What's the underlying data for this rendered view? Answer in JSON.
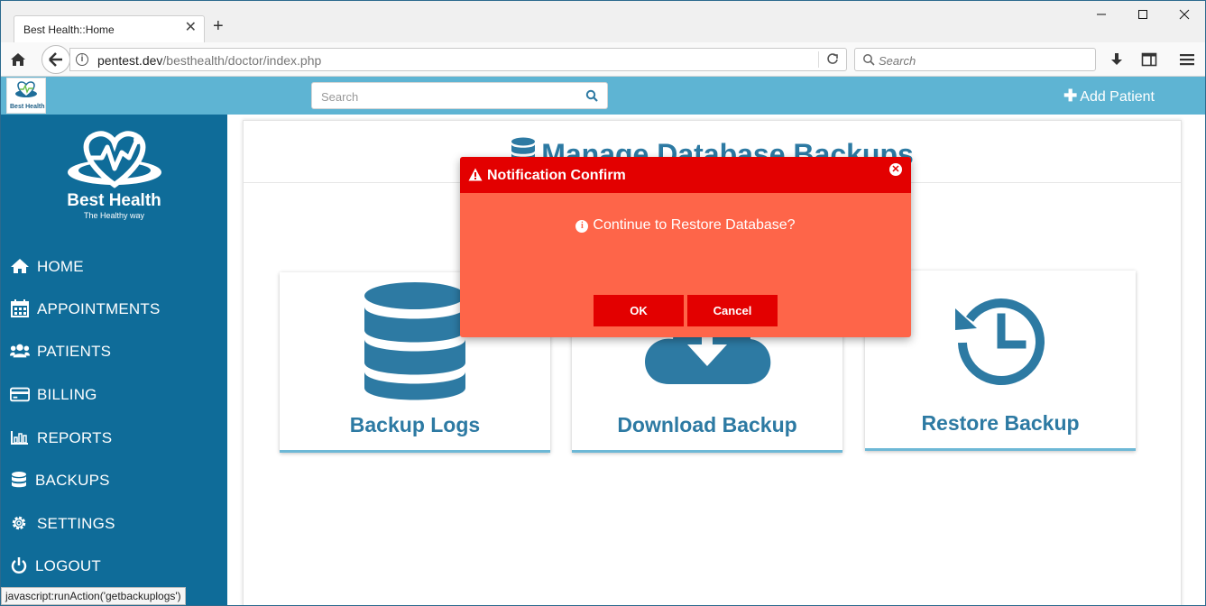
{
  "browser": {
    "tab_title": "Best Health::Home",
    "tab_close": "✕",
    "new_tab": "+",
    "url_host": "pentest.dev",
    "url_path": "/besthealth/doctor/index.php",
    "search_placeholder": "Search",
    "status_text": "javascript:runAction('getbackuplogs')"
  },
  "header": {
    "logo_text": "Best Health",
    "search_placeholder": "Search",
    "add_patient": "Add Patient"
  },
  "sidebar": {
    "brand_name": "Best Health",
    "brand_tagline": "The Healthy way",
    "items": [
      {
        "label": "HOME",
        "icon": "home-icon"
      },
      {
        "label": "APPOINTMENTS",
        "icon": "calendar-icon"
      },
      {
        "label": "PATIENTS",
        "icon": "users-icon"
      },
      {
        "label": "BILLING",
        "icon": "credit-card-icon"
      },
      {
        "label": "REPORTS",
        "icon": "bar-chart-icon"
      },
      {
        "label": "BACKUPS",
        "icon": "database-icon"
      },
      {
        "label": "SETTINGS",
        "icon": "gear-icon"
      },
      {
        "label": "LOGOUT",
        "icon": "power-icon"
      }
    ]
  },
  "main": {
    "title": "Manage Database Backups",
    "cards": [
      {
        "label": "Backup Logs",
        "icon": "database-icon"
      },
      {
        "label": "Download Backup",
        "icon": "cloud-download-icon"
      },
      {
        "label": "Restore Backup",
        "icon": "history-icon"
      }
    ]
  },
  "modal": {
    "title": "Notification Confirm",
    "message": "Continue to Restore Database?",
    "ok_label": "OK",
    "cancel_label": "Cancel"
  },
  "colors": {
    "sidebar_bg": "#0f6c99",
    "header_bg": "#5eb4d3",
    "accent_blue": "#2d7aa3",
    "modal_bg": "#fe6549",
    "modal_head": "#e30000"
  }
}
